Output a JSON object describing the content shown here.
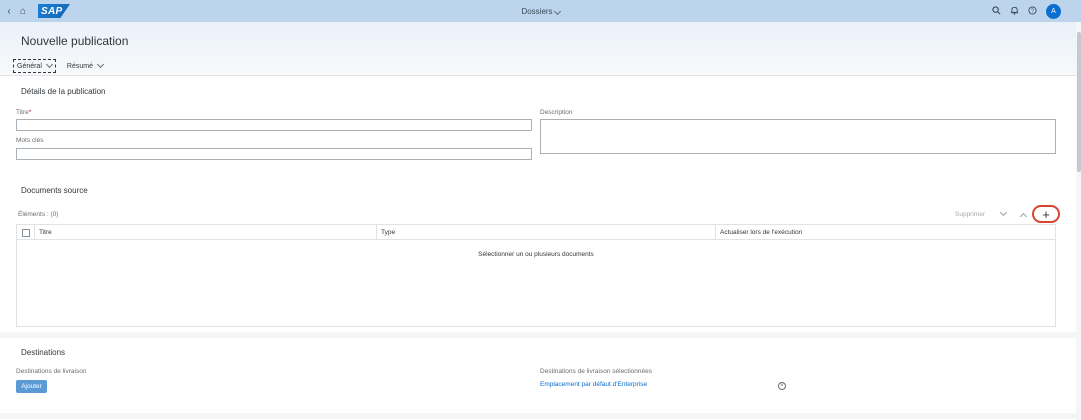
{
  "shell": {
    "back_icon": "chevron-left-icon",
    "home_icon": "home-icon",
    "logo_text": "SAP",
    "title": "Dossiers",
    "search_icon": "search-icon",
    "bell_icon": "bell-icon",
    "help_icon": "help-icon",
    "avatar_initial": "A",
    "brand_color": "#0a6ed1"
  },
  "header": {
    "title": "Nouvelle publication",
    "tabs": [
      {
        "label": "Général",
        "active": true
      },
      {
        "label": "Résumé",
        "active": false
      }
    ]
  },
  "details": {
    "section_title": "Détails de la publication",
    "title_label": "Titre",
    "title_required": "*",
    "title_value": "",
    "keywords_label": "Mots clés",
    "keywords_value": "",
    "description_label": "Description",
    "description_value": ""
  },
  "source_docs": {
    "section_title": "Documents source",
    "items_count": "Éléments : (0)",
    "delete_label": "Supprimer",
    "add_label": "+",
    "columns": [
      "Titre",
      "Type",
      "Actualiser lors de l'exécution"
    ],
    "empty_text": "Sélectionner un ou plusieurs documents",
    "highlight_color": "#d9432f"
  },
  "destinations": {
    "section_title": "Destinations",
    "delivery_label": "Destinations de livraison",
    "add_button": "Ajouter",
    "selected_label": "Destinations de livraison sélectionnées",
    "selected_items": [
      "Emplacement par défaut d'Enterprise"
    ],
    "remove_icon": "close-circle-icon"
  }
}
